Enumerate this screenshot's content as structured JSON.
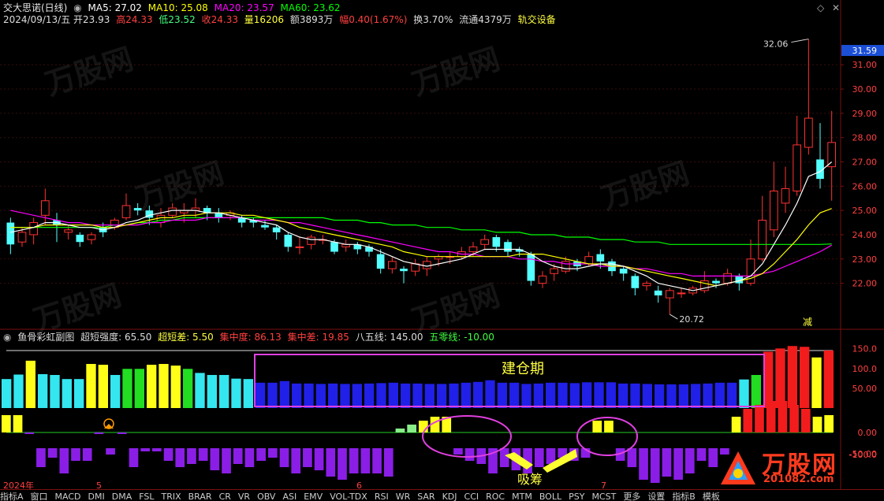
{
  "header": {
    "name": "交大思诺(日线)",
    "ma5": "MA5: 27.02",
    "ma10": "MA10: 25.08",
    "ma20": "MA20: 23.57",
    "ma60": "MA60: 23.62",
    "date": "2024/09/13/五",
    "open": "开23.93",
    "high": "高24.33",
    "low": "低23.52",
    "close": "收24.33",
    "volume": "量16206",
    "amount": "额3893万",
    "change": "幅0.40(1.67%)",
    "turnover": "换3.70%",
    "float": "流通4379万",
    "sector": "轨交设备"
  },
  "sub_header": {
    "title": "鱼骨彩虹副图",
    "strength": "超短强度: 65.50",
    "diff": "超短差: 5.50",
    "concentration": "集中度: 86.13",
    "conc_diff": "集中差: 19.85",
    "line85": "八五线: 145.00",
    "line50": "五零线: -10.00"
  },
  "annotations": {
    "build_period": "建仓期",
    "absorb": "吸筹",
    "reduce": "减",
    "high_mark": "32.06",
    "low_mark": "20.72",
    "last_price": "31.59"
  },
  "price_axis_labels": [
    "31.00",
    "30.00",
    "29.00",
    "28.00",
    "27.00",
    "26.00",
    "25.00",
    "24.00",
    "23.00",
    "22.00"
  ],
  "sub_axis_labels": [
    "150.0",
    "100.0",
    "50.00",
    "0.00",
    "-50.00",
    "-100.0"
  ],
  "time_axis": {
    "labels": [
      "2024年",
      "5",
      "6",
      "7"
    ]
  },
  "bottom_tabs": [
    "指标A",
    "窗口",
    "MACD",
    "DMI",
    "DMA",
    "FSL",
    "TRIX",
    "BRAR",
    "CR",
    "VR",
    "OBV",
    "ASI",
    "EMV",
    "VOL-TDX",
    "RSI",
    "WR",
    "SAR",
    "KDJ",
    "CCI",
    "ROC",
    "MTM",
    "BOLL",
    "PSY",
    "MCST",
    "更多",
    "设置",
    "指标B",
    "模板"
  ],
  "watermark": "万股网",
  "logo": {
    "text": "万股网",
    "url_text": "201082.com"
  },
  "colors": {
    "up": "#ff3232",
    "down": "#54ffff",
    "ma5": "#ffffff",
    "ma10": "#ffff00",
    "ma20": "#ff00ff",
    "ma60": "#00ff00",
    "frame": "#7a1010"
  },
  "chart_data": [
    {
      "type": "candlestick",
      "title": "交大思诺(日线)",
      "ylim": [
        20.3,
        32.5
      ],
      "candles": [
        [
          24.5,
          23.6,
          24.7,
          23.2
        ],
        [
          23.7,
          24.1,
          24.3,
          23.5
        ],
        [
          24.0,
          24.5,
          24.7,
          23.6
        ],
        [
          24.8,
          25.4,
          25.9,
          24.4
        ],
        [
          24.6,
          24.4,
          24.9,
          23.7
        ],
        [
          24.1,
          24.2,
          24.4,
          23.8
        ],
        [
          24.0,
          23.7,
          24.1,
          23.5
        ],
        [
          23.8,
          24.0,
          24.1,
          23.6
        ],
        [
          24.3,
          24.1,
          24.5,
          23.9
        ],
        [
          24.3,
          24.6,
          24.7,
          24.2
        ],
        [
          24.7,
          25.2,
          25.7,
          24.6
        ],
        [
          25.1,
          25.0,
          25.3,
          24.8
        ],
        [
          25.0,
          24.7,
          25.2,
          24.4
        ],
        [
          24.5,
          24.8,
          25.1,
          24.3
        ],
        [
          24.8,
          25.1,
          25.3,
          24.7
        ],
        [
          24.9,
          25.0,
          25.3,
          24.5
        ],
        [
          25.0,
          25.1,
          25.5,
          24.7
        ],
        [
          25.1,
          24.9,
          25.2,
          24.6
        ],
        [
          24.9,
          24.7,
          25.1,
          24.5
        ],
        [
          24.8,
          24.9,
          25.0,
          24.6
        ],
        [
          24.7,
          24.5,
          24.8,
          24.3
        ],
        [
          24.6,
          24.5,
          24.7,
          24.3
        ],
        [
          24.4,
          24.3,
          24.6,
          24.2
        ],
        [
          24.3,
          24.1,
          24.4,
          23.8
        ],
        [
          24.0,
          23.5,
          24.1,
          23.3
        ],
        [
          23.5,
          23.5,
          23.9,
          23.2
        ],
        [
          23.6,
          23.9,
          24.0,
          23.4
        ],
        [
          23.8,
          23.8,
          24.0,
          23.6
        ],
        [
          23.7,
          23.3,
          23.8,
          23.2
        ],
        [
          23.5,
          23.6,
          23.8,
          23.3
        ],
        [
          23.6,
          23.4,
          23.7,
          23.2
        ],
        [
          23.5,
          23.3,
          23.6,
          23.1
        ],
        [
          23.2,
          22.6,
          23.4,
          22.4
        ],
        [
          22.6,
          22.9,
          23.1,
          22.4
        ],
        [
          22.6,
          22.5,
          22.7,
          22.0
        ],
        [
          22.5,
          22.8,
          23.0,
          22.3
        ],
        [
          22.6,
          22.9,
          23.1,
          22.3
        ],
        [
          23.0,
          23.1,
          23.2,
          22.7
        ],
        [
          23.1,
          23.1,
          23.3,
          22.8
        ],
        [
          23.1,
          23.3,
          23.5,
          23.0
        ],
        [
          23.3,
          23.5,
          23.7,
          23.1
        ],
        [
          23.6,
          23.8,
          24.0,
          23.4
        ],
        [
          23.9,
          23.5,
          24.0,
          23.3
        ],
        [
          23.7,
          23.3,
          23.8,
          23.1
        ],
        [
          23.4,
          23.3,
          23.5,
          23.1
        ],
        [
          23.2,
          22.1,
          23.3,
          21.9
        ],
        [
          22.0,
          22.3,
          22.5,
          21.8
        ],
        [
          22.4,
          22.6,
          22.8,
          22.1
        ],
        [
          22.5,
          22.9,
          23.1,
          22.4
        ],
        [
          22.9,
          22.7,
          23.0,
          22.5
        ],
        [
          22.8,
          23.1,
          23.3,
          22.7
        ],
        [
          23.2,
          22.9,
          23.4,
          22.6
        ],
        [
          22.9,
          22.5,
          23.0,
          22.3
        ],
        [
          22.6,
          22.4,
          22.7,
          22.1
        ],
        [
          22.3,
          21.8,
          22.4,
          21.5
        ],
        [
          21.9,
          22.0,
          22.1,
          21.7
        ],
        [
          21.7,
          21.5,
          21.9,
          21.2
        ],
        [
          21.4,
          21.7,
          21.8,
          20.72
        ],
        [
          21.6,
          21.6,
          21.8,
          21.4
        ],
        [
          21.6,
          21.8,
          21.9,
          21.5
        ],
        [
          21.7,
          22.1,
          22.5,
          21.6
        ],
        [
          22.1,
          22.0,
          22.2,
          21.8
        ],
        [
          22.0,
          22.4,
          22.6,
          21.9
        ],
        [
          22.3,
          22.0,
          22.4,
          21.7
        ],
        [
          22.0,
          23.0,
          23.8,
          21.9
        ],
        [
          23.0,
          24.6,
          25.6,
          22.9
        ],
        [
          24.2,
          25.8,
          27.0,
          23.9
        ],
        [
          25.3,
          25.9,
          26.8,
          24.9
        ],
        [
          25.8,
          27.7,
          28.9,
          25.6
        ],
        [
          27.6,
          28.8,
          32.06,
          27.3
        ],
        [
          27.1,
          26.3,
          28.6,
          25.9
        ],
        [
          26.8,
          27.8,
          29.1,
          25.4
        ]
      ],
      "ma5": [
        24.1,
        24.2,
        24.3,
        24.5,
        24.5,
        24.4,
        24.3,
        24.3,
        24.2,
        24.3,
        24.5,
        24.6,
        24.8,
        24.9,
        25.0,
        25.0,
        25.0,
        24.9,
        24.9,
        24.8,
        24.7,
        24.6,
        24.5,
        24.4,
        24.1,
        23.9,
        23.8,
        23.8,
        23.7,
        23.6,
        23.6,
        23.5,
        23.3,
        23.1,
        22.9,
        22.8,
        22.7,
        22.8,
        22.9,
        23.0,
        23.2,
        23.4,
        23.4,
        23.4,
        23.4,
        23.2,
        22.9,
        22.7,
        22.6,
        22.6,
        22.7,
        22.8,
        22.8,
        22.7,
        22.5,
        22.3,
        22.0,
        21.9,
        21.8,
        21.7,
        21.8,
        21.9,
        22.0,
        22.1,
        22.3,
        22.8,
        23.6,
        24.4,
        25.3,
        26.4,
        26.6,
        27.0
      ],
      "ma10": [
        24.3,
        24.3,
        24.3,
        24.4,
        24.4,
        24.4,
        24.4,
        24.4,
        24.3,
        24.3,
        24.4,
        24.5,
        24.6,
        24.7,
        24.7,
        24.8,
        24.8,
        24.9,
        24.9,
        24.9,
        24.8,
        24.8,
        24.7,
        24.6,
        24.5,
        24.3,
        24.2,
        24.1,
        24.0,
        23.9,
        23.8,
        23.7,
        23.6,
        23.5,
        23.3,
        23.2,
        23.1,
        23.1,
        23.1,
        23.1,
        23.1,
        23.1,
        23.1,
        23.1,
        23.2,
        23.2,
        23.2,
        23.1,
        23.0,
        22.9,
        22.8,
        22.8,
        22.7,
        22.7,
        22.6,
        22.5,
        22.4,
        22.3,
        22.2,
        22.1,
        22.0,
        21.9,
        22.0,
        22.1,
        22.2,
        22.4,
        22.8,
        23.3,
        23.8,
        24.4,
        24.9,
        25.08
      ],
      "ma20": [
        25.0,
        24.9,
        24.8,
        24.7,
        24.6,
        24.5,
        24.5,
        24.4,
        24.4,
        24.4,
        24.4,
        24.4,
        24.5,
        24.5,
        24.6,
        24.6,
        24.6,
        24.7,
        24.7,
        24.7,
        24.7,
        24.6,
        24.6,
        24.6,
        24.5,
        24.5,
        24.4,
        24.3,
        24.2,
        24.1,
        24.0,
        23.9,
        23.8,
        23.7,
        23.6,
        23.5,
        23.4,
        23.3,
        23.3,
        23.2,
        23.2,
        23.1,
        23.1,
        23.1,
        23.0,
        23.0,
        22.9,
        22.9,
        22.8,
        22.8,
        22.8,
        22.7,
        22.7,
        22.7,
        22.6,
        22.6,
        22.5,
        22.4,
        22.4,
        22.3,
        22.3,
        22.3,
        22.3,
        22.3,
        22.3,
        22.4,
        22.5,
        22.7,
        22.9,
        23.1,
        23.3,
        23.57
      ],
      "ma60": [
        24.3,
        24.3,
        24.3,
        24.3,
        24.3,
        24.3,
        24.3,
        24.3,
        24.3,
        24.4,
        24.4,
        24.5,
        24.5,
        24.6,
        24.6,
        24.7,
        24.7,
        24.7,
        24.7,
        24.7,
        24.7,
        24.7,
        24.7,
        24.7,
        24.7,
        24.7,
        24.7,
        24.7,
        24.6,
        24.6,
        24.6,
        24.5,
        24.5,
        24.4,
        24.4,
        24.4,
        24.3,
        24.3,
        24.3,
        24.2,
        24.2,
        24.2,
        24.1,
        24.1,
        24.1,
        24.0,
        24.0,
        24.0,
        23.9,
        23.9,
        23.9,
        23.8,
        23.8,
        23.8,
        23.7,
        23.7,
        23.7,
        23.6,
        23.6,
        23.6,
        23.6,
        23.6,
        23.6,
        23.6,
        23.6,
        23.6,
        23.6,
        23.6,
        23.6,
        23.6,
        23.6,
        23.62
      ]
    },
    {
      "type": "bar",
      "title": "鱼骨彩虹副图",
      "ylim": [
        -100,
        170
      ],
      "upper_values": [
        75,
        86,
        120,
        87,
        85,
        75,
        75,
        112,
        110,
        85,
        100,
        100,
        110,
        112,
        108,
        100,
        90,
        85,
        85,
        76,
        75,
        66,
        66,
        70,
        64,
        64,
        63,
        64,
        63,
        63,
        64,
        65,
        66,
        64,
        64,
        63,
        63,
        64,
        66,
        68,
        72,
        66,
        66,
        63,
        64,
        66,
        66,
        65,
        67,
        67,
        67,
        64,
        64,
        63,
        62,
        62,
        62,
        63,
        64,
        66,
        66,
        74,
        85,
        142,
        150,
        156,
        154,
        128,
        145
      ],
      "upper_colors": [
        "cyan",
        "cyan",
        "yellow",
        "cyan",
        "cyan",
        "cyan",
        "cyan",
        "yellow",
        "yellow",
        "cyan",
        "green",
        "green",
        "yellow",
        "yellow",
        "yellow",
        "green",
        "cyan",
        "cyan",
        "cyan",
        "cyan",
        "cyan",
        "blue",
        "blue",
        "blue",
        "blue",
        "blue",
        "blue",
        "blue",
        "blue",
        "blue",
        "blue",
        "blue",
        "blue",
        "blue",
        "blue",
        "blue",
        "blue",
        "blue",
        "blue",
        "blue",
        "blue",
        "blue",
        "blue",
        "blue",
        "blue",
        "blue",
        "blue",
        "blue",
        "blue",
        "blue",
        "blue",
        "blue",
        "blue",
        "blue",
        "blue",
        "blue",
        "blue",
        "blue",
        "blue",
        "blue",
        "blue",
        "cyan",
        "green",
        "red",
        "red",
        "red",
        "red",
        "yellow",
        "red"
      ],
      "lower_values": [
        22,
        22,
        0,
        -30,
        -15,
        -40,
        -20,
        -20,
        0,
        -10,
        0,
        -30,
        -5,
        -5,
        -20,
        -30,
        -25,
        -20,
        -35,
        -40,
        -25,
        -30,
        -20,
        -15,
        -30,
        -40,
        -30,
        -35,
        -45,
        -50,
        -40,
        -40,
        -40,
        -45,
        5,
        10,
        15,
        20,
        20,
        -10,
        -20,
        -25,
        -40,
        -30,
        -35,
        -40,
        -30,
        -25,
        -15,
        -20,
        -15,
        15,
        15,
        -20,
        -30,
        -50,
        -55,
        -45,
        -50,
        -40,
        -20,
        -30,
        -10,
        20,
        30,
        35,
        40,
        40,
        35,
        30,
        20,
        22
      ],
      "lower_colors_note": "red/yellow/green positive bars, purple negative bars"
    }
  ]
}
